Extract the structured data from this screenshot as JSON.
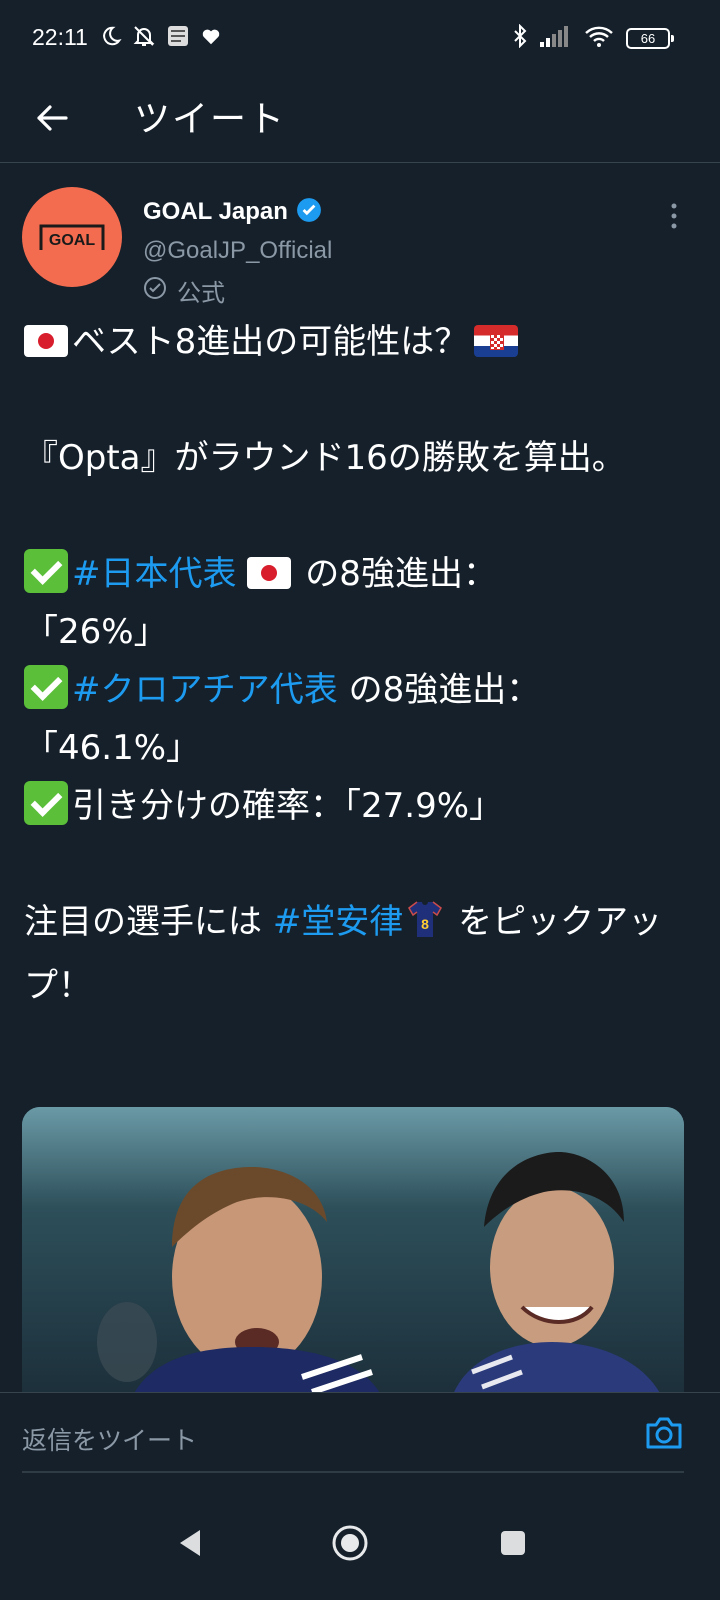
{
  "status": {
    "time": "22:11",
    "battery": "66"
  },
  "header": {
    "title": "ツイート"
  },
  "tweet": {
    "display_name": "GOAL Japan",
    "handle": "@GoalJP_Official",
    "official_label": "公式",
    "avatar_text": "GOAL",
    "lines": {
      "l1": "ベスト8進出の可能性は？",
      "l2": "『Opta』がラウンド16の勝敗を算出。",
      "l3_tag": "#日本代表",
      "l3_rest": " の8強進出：",
      "l4": "「26%」",
      "l5_tag": "#クロアチア代表",
      "l5_rest": " の8強進出：",
      "l6": "「46.1%」",
      "l7": "引き分けの確率：「27.9%」",
      "l8_pre": "注目の選手には ",
      "l8_tag": "#堂安律",
      "l8_post": " をピックアップ！"
    }
  },
  "reply": {
    "placeholder": "返信をツイート"
  },
  "colors": {
    "background": "#15202b",
    "accent": "#1d9bf0",
    "avatar": "#f36c4f",
    "muted": "#8b98a5"
  }
}
